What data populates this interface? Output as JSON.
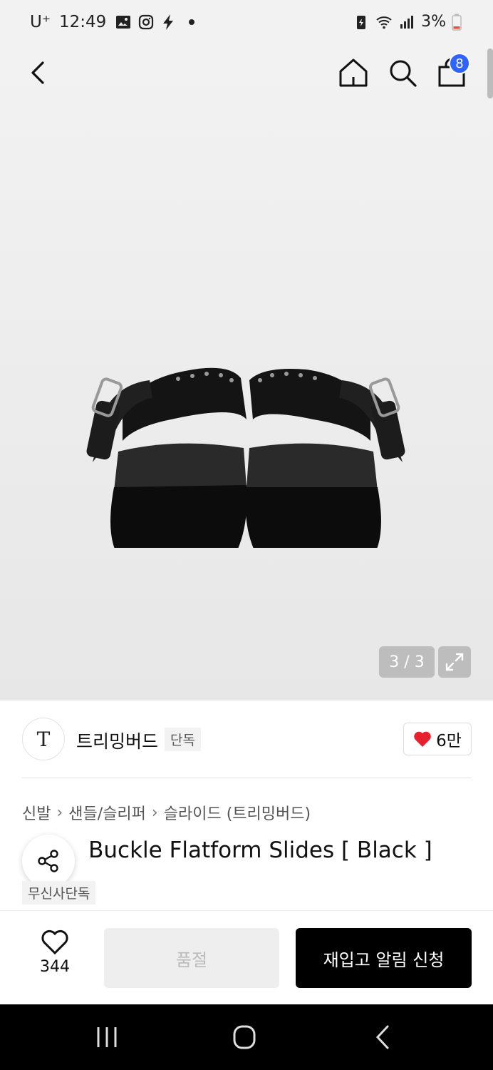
{
  "status_bar": {
    "carrier": "U⁺",
    "time": "12:49",
    "battery": "3%",
    "icons_left": [
      "gallery-icon",
      "instagram-icon",
      "bolt-icon",
      "dot-icon"
    ],
    "icons_right": [
      "battery-saver-icon",
      "wifi-icon",
      "signal-icon",
      "battery-icon"
    ]
  },
  "top_nav": {
    "icons": [
      "back-icon",
      "home-icon",
      "search-icon",
      "bag-icon"
    ],
    "cart_count": "8"
  },
  "gallery": {
    "counter": "3 / 3",
    "expand_icon": "expand-icon"
  },
  "brand": {
    "logo_text": "T",
    "name": "트리밍버드",
    "badge": "단독",
    "likes": "6만"
  },
  "breadcrumb": [
    "신발",
    "샌들/슬리퍼",
    "슬라이드 (트리밍버드)"
  ],
  "product": {
    "title_hidden": "B",
    "title": "Buckle Flatform Slides [ Black ]",
    "tag": "무신사단독"
  },
  "action_bar": {
    "wish_count": "344",
    "soldout_label": "품절",
    "restock_label": "재입고 알림 신청"
  },
  "colors": {
    "badge_blue": "#2f63ff",
    "heart_red": "#e8202e",
    "restock_bg": "#000000"
  }
}
